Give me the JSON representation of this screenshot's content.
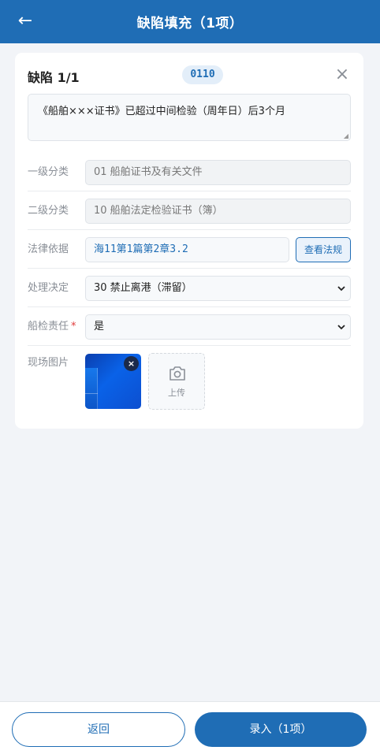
{
  "header": {
    "back_icon": "←",
    "title": "缺陷填充（1项）"
  },
  "defect": {
    "title": "缺陷 1/1",
    "code": "0110",
    "close_icon": "×",
    "description": "《船舶×××证书》已超过中间检验（周年日）后3个月"
  },
  "form": {
    "level1": {
      "label": "一级分类",
      "value": "01 船舶证书及有关文件"
    },
    "level2": {
      "label": "二级分类",
      "value": "10 船舶法定检验证书（簿）"
    },
    "law": {
      "label": "法律依据",
      "value": "海11第1篇第2章3.2",
      "button": "查看法规"
    },
    "decision": {
      "label": "处理决定",
      "value": "30 禁止离港（滞留）"
    },
    "responsibility": {
      "label": "船检责任",
      "required_mark": "*",
      "value": "是"
    },
    "photos": {
      "label": "现场图片",
      "delete_icon": "×",
      "upload_label": "上传"
    }
  },
  "footer": {
    "back_label": "返回",
    "submit_label": "录入（1项）"
  },
  "colors": {
    "primary": "#1f6db5",
    "required": "#e03b3b",
    "background": "#f2f4f8"
  }
}
